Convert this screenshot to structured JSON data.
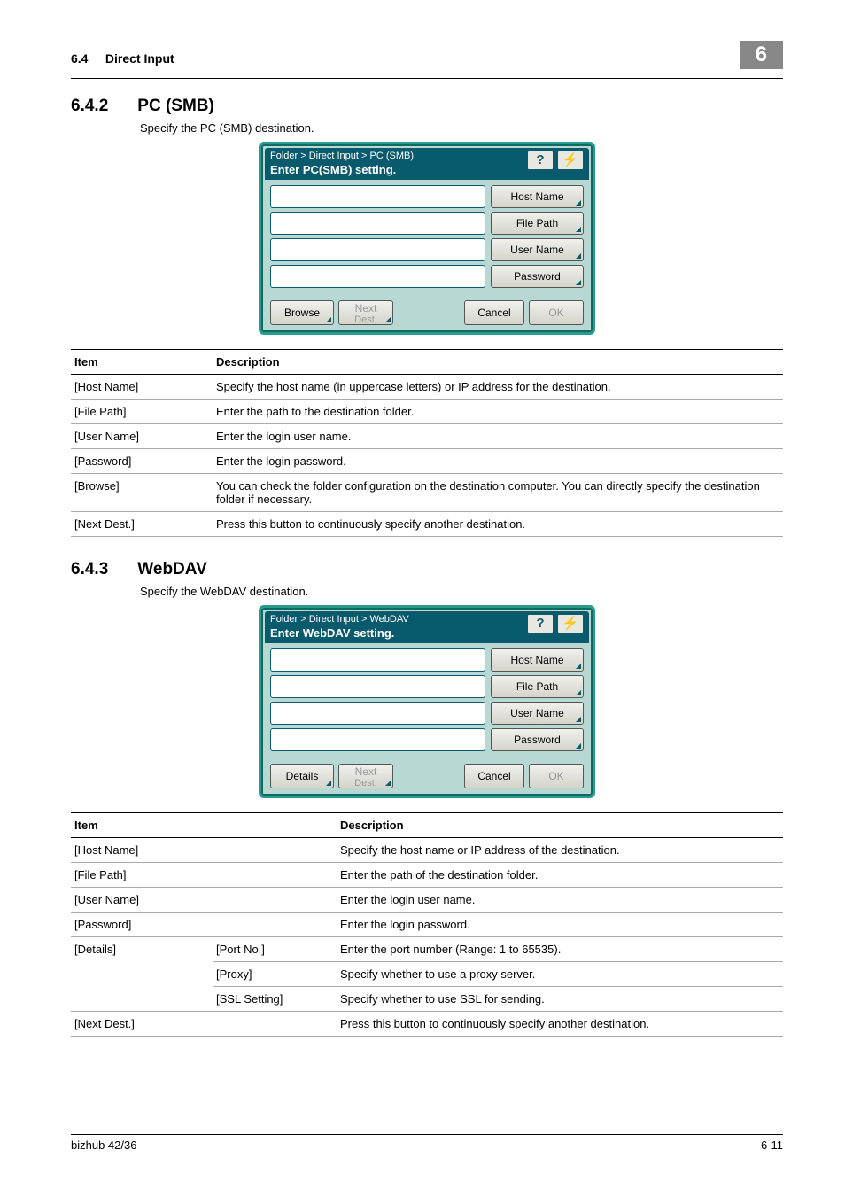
{
  "header": {
    "section": "6.4",
    "title": "Direct Input",
    "chapter_badge": "6"
  },
  "sections": {
    "smb": {
      "number": "6.4.2",
      "heading": "PC (SMB)",
      "intro": "Specify the PC (SMB) destination."
    },
    "webdav": {
      "number": "6.4.3",
      "heading": "WebDAV",
      "intro": "Specify the WebDAV destination."
    }
  },
  "screenshot_smb": {
    "breadcrumb": "Folder > Direct Input > PC (SMB)",
    "subtitle": "Enter PC(SMB) setting.",
    "help_icon": "?",
    "labels": {
      "host_name": "Host Name",
      "file_path": "File Path",
      "user_name": "User Name",
      "password": "Password"
    },
    "buttons": {
      "browse": "Browse",
      "next": "Next",
      "dest": "Dest.",
      "cancel": "Cancel",
      "ok": "OK"
    }
  },
  "screenshot_webdav": {
    "breadcrumb": "Folder > Direct Input > WebDAV",
    "subtitle": "Enter WebDAV setting.",
    "help_icon": "?",
    "labels": {
      "host_name": "Host Name",
      "file_path": "File Path",
      "user_name": "User Name",
      "password": "Password"
    },
    "buttons": {
      "details": "Details",
      "next": "Next",
      "dest": "Dest.",
      "cancel": "Cancel",
      "ok": "OK"
    }
  },
  "table_headers": {
    "item": "Item",
    "description": "Description"
  },
  "table_smb": [
    {
      "item": "[Host Name]",
      "desc": "Specify the host name (in uppercase letters) or IP address for the destination."
    },
    {
      "item": "[File Path]",
      "desc": "Enter the path to the destination folder."
    },
    {
      "item": "[User Name]",
      "desc": "Enter the login user name."
    },
    {
      "item": "[Password]",
      "desc": "Enter the login password."
    },
    {
      "item": "[Browse]",
      "desc": "You can check the folder configuration on the destination computer. You can directly specify the destination folder if necessary."
    },
    {
      "item": "[Next Dest.]",
      "desc": "Press this button to continuously specify another destination."
    }
  ],
  "table_webdav": {
    "rows": [
      {
        "item": "[Host Name]",
        "sub": "",
        "desc": "Specify the host name or IP address of the destination."
      },
      {
        "item": "[File Path]",
        "sub": "",
        "desc": "Enter the path of the destination folder."
      },
      {
        "item": "[User Name]",
        "sub": "",
        "desc": "Enter the login user name."
      },
      {
        "item": "[Password]",
        "sub": "",
        "desc": "Enter the login password."
      }
    ],
    "details_item": "[Details]",
    "details_subs": [
      {
        "sub": "[Port No.]",
        "desc": "Enter the port number (Range: 1 to 65535)."
      },
      {
        "sub": "[Proxy]",
        "desc": "Specify whether to use a proxy server."
      },
      {
        "sub": "[SSL Setting]",
        "desc": "Specify whether to use SSL for sending."
      }
    ],
    "nextdest": {
      "item": "[Next Dest.]",
      "desc": "Press this button to continuously specify another destination."
    }
  },
  "footer": {
    "model": "bizhub 42/36",
    "page": "6-11"
  }
}
